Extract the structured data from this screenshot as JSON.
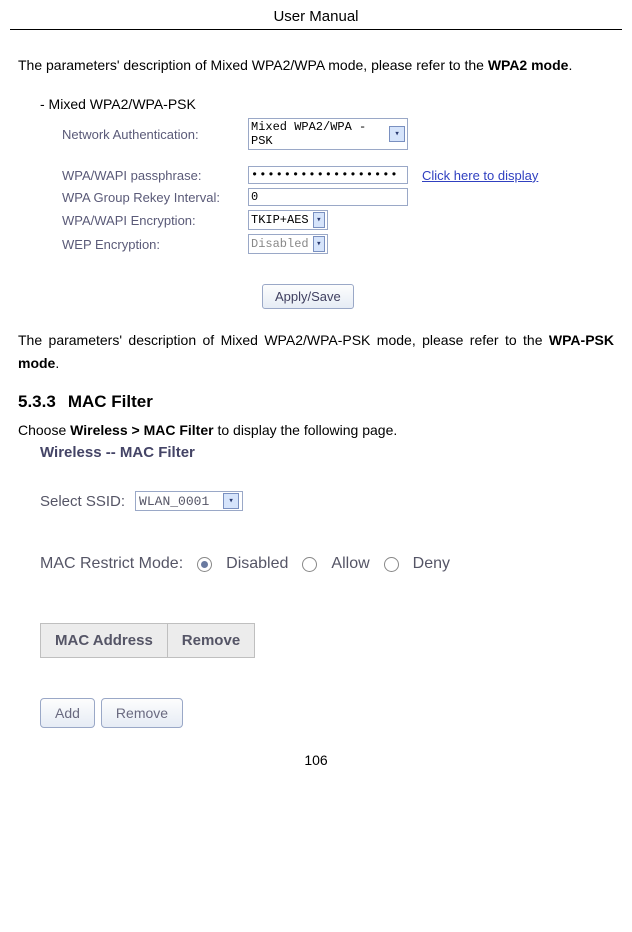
{
  "header": {
    "title": "User Manual"
  },
  "para1_a": "The parameters' description of Mixed WPA2/WPA mode, please refer to the ",
  "para1_b": "WPA2 mode",
  "para1_c": ".",
  "bullet": "-   Mixed WPA2/WPA-PSK",
  "fig1": {
    "labels": {
      "netauth": "Network Authentication:",
      "pass": "WPA/WAPI passphrase:",
      "rekey": "WPA Group Rekey Interval:",
      "enc": "WPA/WAPI Encryption:",
      "wep": "WEP Encryption:"
    },
    "values": {
      "netauth_sel": "Mixed WPA2/WPA -PSK",
      "pass_val": "••••••••••••••••••",
      "pass_link": "Click here to display",
      "rekey_val": "0",
      "enc_sel": "TKIP+AES",
      "wep_sel": "Disabled"
    },
    "apply": "Apply/Save"
  },
  "para2_a": "The parameters' description of Mixed WPA2/WPA-PSK mode, please refer to the ",
  "para2_b": "WPA-PSK mode",
  "para2_c": ".",
  "section": {
    "num": "5.3.3",
    "title": "MAC Filter"
  },
  "choose_a": "Choose ",
  "choose_b": "Wireless > MAC Filter",
  "choose_c": " to display the following page.",
  "fig2": {
    "title": "Wireless -- MAC Filter",
    "ssid_label": "Select SSID:",
    "ssid_val": "WLAN_0001",
    "restrict_label": "MAC Restrict Mode:",
    "opts": {
      "disabled": "Disabled",
      "allow": "Allow",
      "deny": "Deny"
    },
    "th1": "MAC Address",
    "th2": "Remove",
    "add": "Add",
    "remove": "Remove"
  },
  "page_num": "106"
}
